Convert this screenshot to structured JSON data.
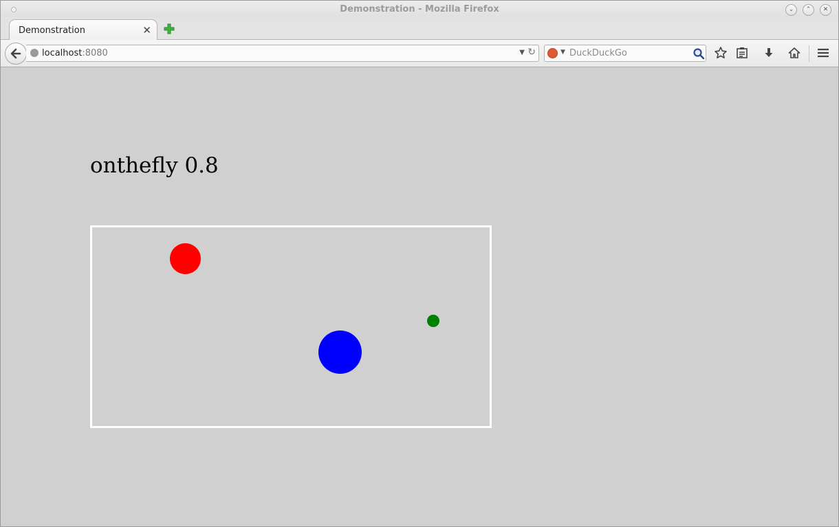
{
  "window": {
    "title": "Demonstration - Mozilla Firefox"
  },
  "tabs": [
    {
      "label": "Demonstration",
      "active": true
    }
  ],
  "navbar": {
    "url_host": "localhost",
    "url_port": ":8080",
    "search_placeholder": "DuckDuckGo"
  },
  "page": {
    "heading": "onthefly 0.8",
    "stage": {
      "border_color": "#ffffff",
      "balls": [
        {
          "name": "red-ball",
          "color": "#ff0000"
        },
        {
          "name": "green-ball",
          "color": "#008000"
        },
        {
          "name": "blue-ball",
          "color": "#0000ff"
        }
      ]
    }
  },
  "icons": [
    "globe-icon",
    "back-arrow-icon",
    "dropdown-arrow-icon",
    "reload-icon",
    "duckduckgo-icon",
    "search-icon",
    "star-icon",
    "reading-list-icon",
    "download-icon",
    "home-icon",
    "hamburger-menu-icon",
    "new-tab-icon",
    "close-icon"
  ]
}
